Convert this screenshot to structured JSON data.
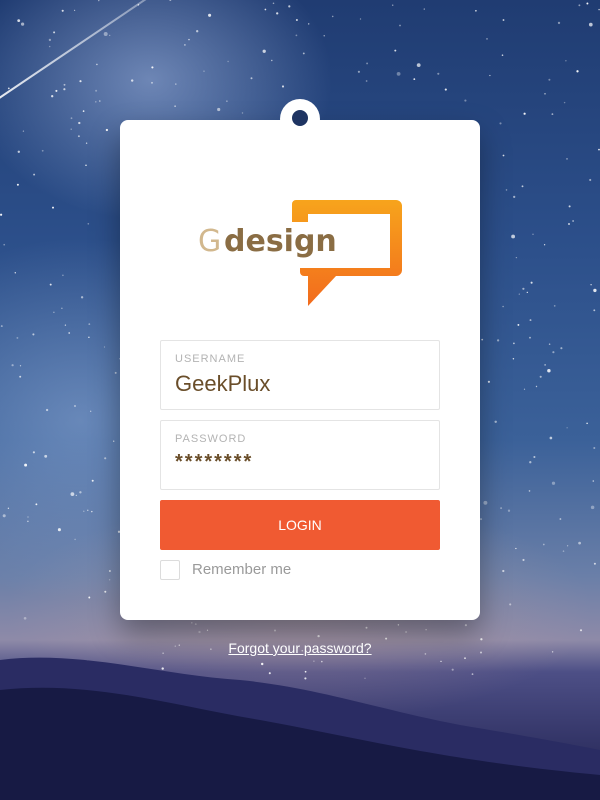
{
  "logo": {
    "g_text": "G",
    "design_text": "design"
  },
  "form": {
    "username": {
      "label": "USERNAME",
      "value": "GeekPlux"
    },
    "password": {
      "label": "PASSWORD",
      "value": "********"
    },
    "login_label": "LOGIN",
    "remember_label": "Remember me",
    "remember_checked": false
  },
  "forgot_link": "Forgot your password?",
  "colors": {
    "accent": "#f05a32",
    "logo_orange": "#f5a01a",
    "logo_brown": "#8a6d44",
    "logo_tan": "#d2b88e"
  },
  "icons": {
    "logo_bubble": "speech-bubble-icon",
    "hanger": "card-hanger-icon"
  }
}
